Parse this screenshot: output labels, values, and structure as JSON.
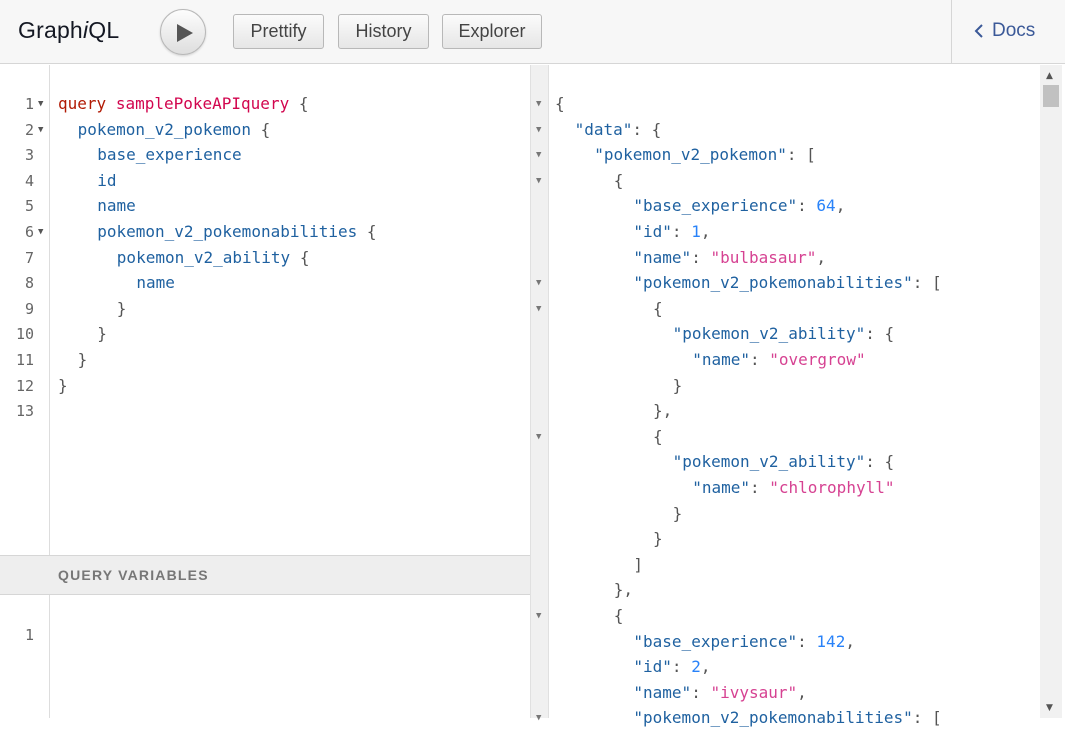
{
  "app": {
    "title_prefix": "Graph",
    "title_i": "i",
    "title_suffix": "QL"
  },
  "toolbar": {
    "prettify_label": "Prettify",
    "history_label": "History",
    "explorer_label": "Explorer",
    "docs_label": "Docs"
  },
  "query_editor": {
    "line_numbers": [
      "1",
      "2",
      "3",
      "4",
      "5",
      "6",
      "7",
      "8",
      "9",
      "10",
      "11",
      "12",
      "13"
    ],
    "lines": [
      {
        "indent": 0,
        "tokens": [
          {
            "t": "query",
            "c": "kw"
          },
          {
            "t": " ",
            "c": ""
          },
          {
            "t": "samplePokeAPIquery",
            "c": "def"
          },
          {
            "t": " {",
            "c": "punc"
          }
        ],
        "fold": true
      },
      {
        "indent": 1,
        "tokens": [
          {
            "t": "pokemon_v2_pokemon",
            "c": "fld"
          },
          {
            "t": " {",
            "c": "punc"
          }
        ],
        "fold": true
      },
      {
        "indent": 2,
        "tokens": [
          {
            "t": "base_experience",
            "c": "fld"
          }
        ],
        "fold": false
      },
      {
        "indent": 2,
        "tokens": [
          {
            "t": "id",
            "c": "fld"
          }
        ],
        "fold": false
      },
      {
        "indent": 2,
        "tokens": [
          {
            "t": "name",
            "c": "fld"
          }
        ],
        "fold": false
      },
      {
        "indent": 2,
        "tokens": [
          {
            "t": "pokemon_v2_pokemonabilities",
            "c": "fld"
          },
          {
            "t": " {",
            "c": "punc"
          }
        ],
        "fold": true
      },
      {
        "indent": 3,
        "tokens": [
          {
            "t": "pokemon_v2_ability",
            "c": "fld"
          },
          {
            "t": " {",
            "c": "punc"
          }
        ],
        "fold": false
      },
      {
        "indent": 4,
        "tokens": [
          {
            "t": "name",
            "c": "fld"
          }
        ],
        "fold": false
      },
      {
        "indent": 3,
        "tokens": [
          {
            "t": "}",
            "c": "punc"
          }
        ],
        "fold": false
      },
      {
        "indent": 2,
        "tokens": [
          {
            "t": "}",
            "c": "punc"
          }
        ],
        "fold": false
      },
      {
        "indent": 1,
        "tokens": [
          {
            "t": "}",
            "c": "punc"
          }
        ],
        "fold": false
      },
      {
        "indent": 0,
        "tokens": [
          {
            "t": "}",
            "c": "punc"
          }
        ],
        "fold": false
      },
      {
        "indent": 0,
        "tokens": [],
        "fold": false
      }
    ]
  },
  "variables": {
    "header": "QUERY VARIABLES",
    "line_numbers": [
      "1"
    ]
  },
  "result": {
    "lines": [
      {
        "indent": 0,
        "fold": true,
        "tokens": [
          {
            "t": "{",
            "c": "rp"
          }
        ]
      },
      {
        "indent": 1,
        "fold": true,
        "tokens": [
          {
            "t": "\"data\"",
            "c": "rkey"
          },
          {
            "t": ": {",
            "c": "rp"
          }
        ]
      },
      {
        "indent": 2,
        "fold": true,
        "tokens": [
          {
            "t": "\"pokemon_v2_pokemon\"",
            "c": "rkey"
          },
          {
            "t": ": [",
            "c": "rp"
          }
        ]
      },
      {
        "indent": 3,
        "fold": true,
        "tokens": [
          {
            "t": "{",
            "c": "rp"
          }
        ]
      },
      {
        "indent": 4,
        "fold": false,
        "tokens": [
          {
            "t": "\"base_experience\"",
            "c": "rkey"
          },
          {
            "t": ": ",
            "c": "rp"
          },
          {
            "t": "64",
            "c": "rnum"
          },
          {
            "t": ",",
            "c": "rp"
          }
        ]
      },
      {
        "indent": 4,
        "fold": false,
        "tokens": [
          {
            "t": "\"id\"",
            "c": "rkey"
          },
          {
            "t": ": ",
            "c": "rp"
          },
          {
            "t": "1",
            "c": "rnum"
          },
          {
            "t": ",",
            "c": "rp"
          }
        ]
      },
      {
        "indent": 4,
        "fold": false,
        "tokens": [
          {
            "t": "\"name\"",
            "c": "rkey"
          },
          {
            "t": ": ",
            "c": "rp"
          },
          {
            "t": "\"bulbasaur\"",
            "c": "rstr"
          },
          {
            "t": ",",
            "c": "rp"
          }
        ]
      },
      {
        "indent": 4,
        "fold": true,
        "tokens": [
          {
            "t": "\"pokemon_v2_pokemonabilities\"",
            "c": "rkey"
          },
          {
            "t": ": [",
            "c": "rp"
          }
        ]
      },
      {
        "indent": 5,
        "fold": true,
        "tokens": [
          {
            "t": "{",
            "c": "rp"
          }
        ]
      },
      {
        "indent": 6,
        "fold": false,
        "tokens": [
          {
            "t": "\"pokemon_v2_ability\"",
            "c": "rkey"
          },
          {
            "t": ": {",
            "c": "rp"
          }
        ]
      },
      {
        "indent": 7,
        "fold": false,
        "tokens": [
          {
            "t": "\"name\"",
            "c": "rkey"
          },
          {
            "t": ": ",
            "c": "rp"
          },
          {
            "t": "\"overgrow\"",
            "c": "rstr"
          }
        ]
      },
      {
        "indent": 6,
        "fold": false,
        "tokens": [
          {
            "t": "}",
            "c": "rp"
          }
        ]
      },
      {
        "indent": 5,
        "fold": false,
        "tokens": [
          {
            "t": "},",
            "c": "rp"
          }
        ]
      },
      {
        "indent": 5,
        "fold": true,
        "tokens": [
          {
            "t": "{",
            "c": "rp"
          }
        ]
      },
      {
        "indent": 6,
        "fold": false,
        "tokens": [
          {
            "t": "\"pokemon_v2_ability\"",
            "c": "rkey"
          },
          {
            "t": ": {",
            "c": "rp"
          }
        ]
      },
      {
        "indent": 7,
        "fold": false,
        "tokens": [
          {
            "t": "\"name\"",
            "c": "rkey"
          },
          {
            "t": ": ",
            "c": "rp"
          },
          {
            "t": "\"chlorophyll\"",
            "c": "rstr"
          }
        ]
      },
      {
        "indent": 6,
        "fold": false,
        "tokens": [
          {
            "t": "}",
            "c": "rp"
          }
        ]
      },
      {
        "indent": 5,
        "fold": false,
        "tokens": [
          {
            "t": "}",
            "c": "rp"
          }
        ]
      },
      {
        "indent": 4,
        "fold": false,
        "tokens": [
          {
            "t": "]",
            "c": "rp"
          }
        ]
      },
      {
        "indent": 3,
        "fold": false,
        "tokens": [
          {
            "t": "},",
            "c": "rp"
          }
        ]
      },
      {
        "indent": 3,
        "fold": true,
        "tokens": [
          {
            "t": "{",
            "c": "rp"
          }
        ]
      },
      {
        "indent": 4,
        "fold": false,
        "tokens": [
          {
            "t": "\"base_experience\"",
            "c": "rkey"
          },
          {
            "t": ": ",
            "c": "rp"
          },
          {
            "t": "142",
            "c": "rnum"
          },
          {
            "t": ",",
            "c": "rp"
          }
        ]
      },
      {
        "indent": 4,
        "fold": false,
        "tokens": [
          {
            "t": "\"id\"",
            "c": "rkey"
          },
          {
            "t": ": ",
            "c": "rp"
          },
          {
            "t": "2",
            "c": "rnum"
          },
          {
            "t": ",",
            "c": "rp"
          }
        ]
      },
      {
        "indent": 4,
        "fold": false,
        "tokens": [
          {
            "t": "\"name\"",
            "c": "rkey"
          },
          {
            "t": ": ",
            "c": "rp"
          },
          {
            "t": "\"ivysaur\"",
            "c": "rstr"
          },
          {
            "t": ",",
            "c": "rp"
          }
        ]
      },
      {
        "indent": 4,
        "fold": true,
        "tokens": [
          {
            "t": "\"pokemon_v2_pokemonabilities\"",
            "c": "rkey"
          },
          {
            "t": ": [",
            "c": "rp"
          }
        ]
      }
    ]
  },
  "colors": {
    "keyword": "#b11a04",
    "definition": "#d2054e",
    "field": "#1f61a0",
    "string": "#d64292",
    "number": "#2882f9",
    "docs_link": "#3b5998"
  }
}
